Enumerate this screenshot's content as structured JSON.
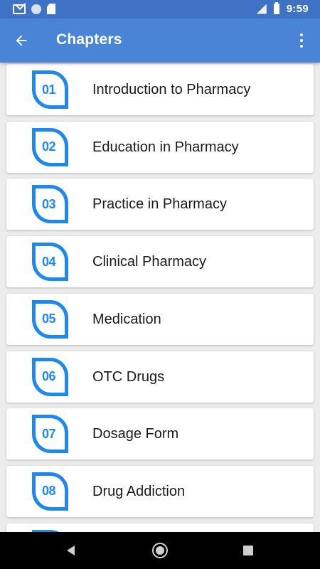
{
  "status_bar": {
    "time": "9:59",
    "icons": [
      "gmail-icon",
      "notification-dot-icon",
      "sd-card-icon",
      "signal-icon",
      "battery-icon"
    ]
  },
  "app_bar": {
    "title": "Chapters",
    "back_icon": "arrow-left-icon",
    "menu_icon": "more-vertical-icon",
    "background": "#4a84d6"
  },
  "colors": {
    "status_bar": "#3d72c5",
    "badge": "#1e88f0",
    "list_background": "#ececec",
    "card": "#ffffff"
  },
  "chapters": [
    {
      "number": "01",
      "title": "Introduction to Pharmacy"
    },
    {
      "number": "02",
      "title": "Education in Pharmacy"
    },
    {
      "number": "03",
      "title": "Practice in Pharmacy"
    },
    {
      "number": "04",
      "title": "Clinical Pharmacy"
    },
    {
      "number": "05",
      "title": "Medication"
    },
    {
      "number": "06",
      "title": "OTC Drugs"
    },
    {
      "number": "07",
      "title": "Dosage Form"
    },
    {
      "number": "08",
      "title": "Drug Addiction"
    },
    {
      "number": "",
      "title": ""
    }
  ],
  "nav_bar": {
    "icons": [
      "nav-back-icon",
      "nav-home-icon",
      "nav-recents-icon"
    ]
  }
}
